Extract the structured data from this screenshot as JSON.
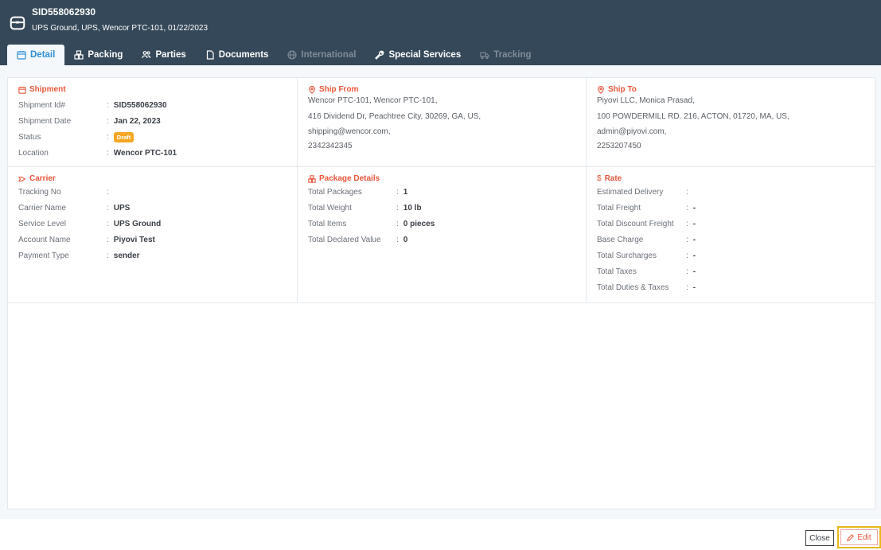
{
  "header": {
    "title": "SID558062930",
    "subtitle": "UPS Ground, UPS, Wencor PTC-101, 01/22/2023",
    "icon": "package-icon"
  },
  "tabs": [
    {
      "label": "Detail",
      "icon": "calendar-icon",
      "state": "active"
    },
    {
      "label": "Packing",
      "icon": "boxes-icon",
      "state": "normal"
    },
    {
      "label": "Parties",
      "icon": "people-icon",
      "state": "normal"
    },
    {
      "label": "Documents",
      "icon": "document-icon",
      "state": "normal"
    },
    {
      "label": "International",
      "icon": "globe-icon",
      "state": "disabled"
    },
    {
      "label": "Special Services",
      "icon": "wrench-icon",
      "state": "normal"
    },
    {
      "label": "Tracking",
      "icon": "truck-icon",
      "state": "disabled"
    }
  ],
  "shipment": {
    "title": "Shipment",
    "id_label": "Shipment Id#",
    "id_value": "SID558062930",
    "date_label": "Shipment Date",
    "date_value": "Jan 22, 2023",
    "status_label": "Status",
    "status_value": "Draft",
    "location_label": "Location",
    "location_value": "Wencor PTC-101"
  },
  "ship_from": {
    "title": "Ship From",
    "line1": "Wencor PTC-101, Wencor PTC-101,",
    "line2": "416 Dividend Dr, Peachtree City, 30269, GA, US,",
    "line3": "shipping@wencor.com,",
    "line4": "2342342345"
  },
  "ship_to": {
    "title": "Ship To",
    "line1": "Piyovi LLC, Monica Prasad,",
    "line2": "100 POWDERMILL RD. 216, ACTON, 01720, MA, US,",
    "line3": "admin@piyovi.com,",
    "line4": "2253207450"
  },
  "carrier": {
    "title": "Carrier",
    "tracking_label": "Tracking No",
    "tracking_value": "",
    "name_label": "Carrier Name",
    "name_value": "UPS",
    "service_label": "Service Level",
    "service_value": "UPS Ground",
    "account_label": "Account Name",
    "account_value": "Piyovi Test",
    "payment_label": "Payment Type",
    "payment_value": "sender"
  },
  "package": {
    "title": "Package Details",
    "packages_label": "Total Packages",
    "packages_value": "1",
    "weight_label": "Total Weight",
    "weight_value": "10 lb",
    "items_label": "Total Items",
    "items_value": "0 pieces",
    "declared_label": "Total Declared Value",
    "declared_value": "0"
  },
  "rate": {
    "title": "Rate",
    "delivery_label": "Estimated Delivery",
    "delivery_value": "",
    "freight_label": "Total Freight",
    "freight_value": "-",
    "discount_label": "Total Discount Freight",
    "discount_value": "-",
    "base_label": "Base Charge",
    "base_value": "-",
    "surcharges_label": "Total Surcharges",
    "surcharges_value": "-",
    "taxes_label": "Total Taxes",
    "taxes_value": "-",
    "duties_label": "Total Duties & Taxes",
    "duties_value": "-"
  },
  "footer": {
    "close_label": "Close",
    "edit_label": "Edit"
  },
  "colors": {
    "header_bg": "#354859",
    "accent": "#e8563b",
    "active_tab": "#2f8fd8",
    "badge": "#f5a623",
    "highlight": "#e8b818"
  }
}
